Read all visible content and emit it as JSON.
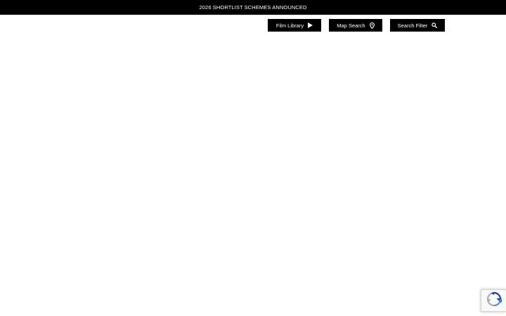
{
  "announcement": {
    "text": "2026 SHORTLIST SCHEMES ANNOUNCED"
  },
  "nav": {
    "film_library": {
      "label": "Film Library",
      "icon": "play-icon"
    },
    "map_search": {
      "label": "Map Search",
      "icon": "map-pin-icon"
    },
    "search_filter": {
      "label": "Search Filter",
      "icon": "search-icon"
    }
  },
  "recaptcha": {
    "icon": "recaptcha-icon"
  },
  "colors": {
    "bar_bg": "#000000",
    "button_bg": "#000000",
    "button_text": "#ffffff",
    "page_bg": "#ffffff",
    "recaptcha_blue": "#1c3aa9",
    "recaptcha_light_blue": "#4a90e2",
    "recaptcha_gray": "#ababab"
  }
}
